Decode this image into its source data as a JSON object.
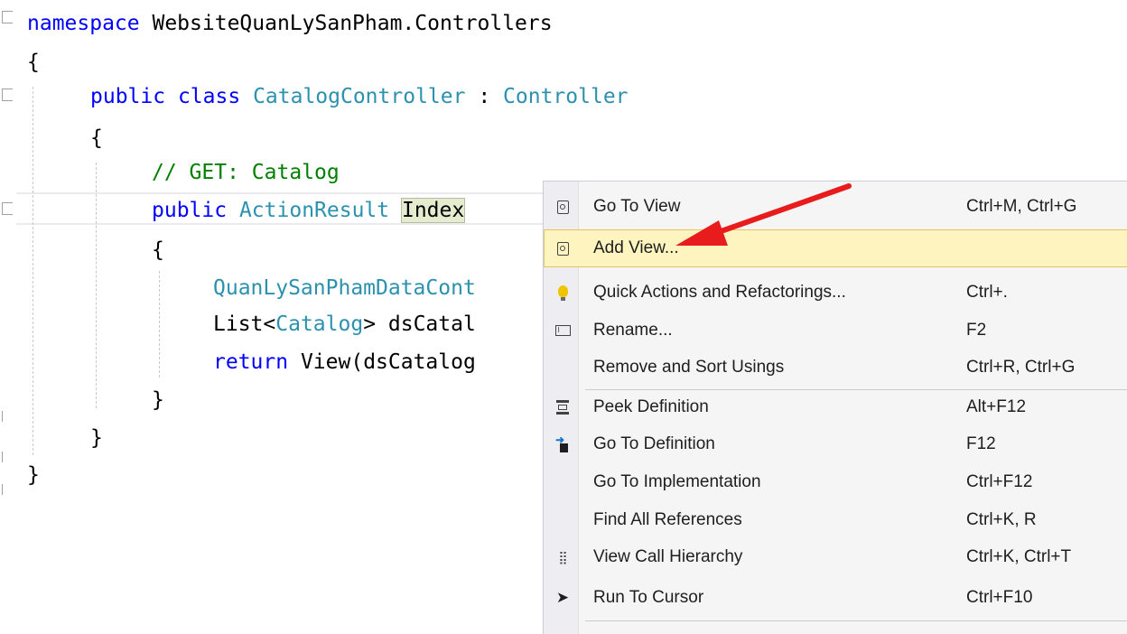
{
  "code": {
    "lines": [
      "namespace",
      "WebsiteQuanLySanPham.Controllers",
      "{",
      "public",
      "class",
      "CatalogController",
      ":",
      "Controller",
      "{",
      "// GET: Catalog",
      "public",
      "ActionResult",
      "Index",
      "{",
      "QuanLySanPhamDataCont",
      "List<",
      "Catalog",
      "> dsCatal",
      "return",
      "View(dsCatalog",
      "}",
      "}",
      "}"
    ]
  },
  "context_menu": {
    "items": [
      {
        "label": "Go To View",
        "shortcut": "Ctrl+M, Ctrl+G",
        "icon": "go-to-view-icon"
      },
      {
        "label": "Add View...",
        "shortcut": "",
        "icon": "add-view-icon"
      },
      {
        "label": "Quick Actions and Refactorings...",
        "shortcut": "Ctrl+.",
        "icon": "lightbulb-icon"
      },
      {
        "label": "Rename...",
        "shortcut": "F2",
        "icon": "rename-icon"
      },
      {
        "label": "Remove and Sort Usings",
        "shortcut": "Ctrl+R, Ctrl+G",
        "icon": ""
      },
      {
        "label": "Peek Definition",
        "shortcut": "Alt+F12",
        "icon": "peek-definition-icon"
      },
      {
        "label": "Go To Definition",
        "shortcut": "F12",
        "icon": "go-to-definition-icon"
      },
      {
        "label": "Go To Implementation",
        "shortcut": "Ctrl+F12",
        "icon": ""
      },
      {
        "label": "Find All References",
        "shortcut": "Ctrl+K, R",
        "icon": ""
      },
      {
        "label": "View Call Hierarchy",
        "shortcut": "Ctrl+K, Ctrl+T",
        "icon": "call-hierarchy-icon"
      },
      {
        "label": "Run To Cursor",
        "shortcut": "Ctrl+F10",
        "icon": "cursor-arrow-icon"
      }
    ],
    "highlighted_item": "Add View..."
  },
  "colors": {
    "keyword": "#0000ff",
    "type": "#2b91af",
    "comment": "#008000",
    "menu_hover": "#fdf4bf",
    "annotation_arrow": "#e81c1c"
  }
}
